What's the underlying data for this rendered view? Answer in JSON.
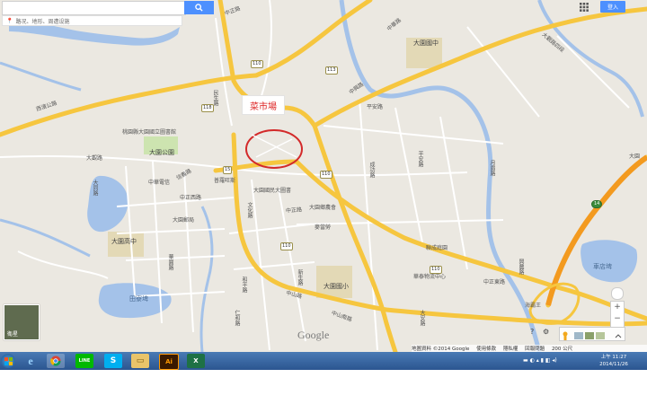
{
  "search": {
    "placeholder": "",
    "hint": "路况、地形、周遭设施"
  },
  "header": {
    "login_label": "登入"
  },
  "map": {
    "annotation": "菜市場",
    "roads": [
      "中正路",
      "中華路",
      "民族路",
      "西濱公路",
      "中興路",
      "大觀路",
      "平安路",
      "月眉路",
      "和平路",
      "仁和路",
      "新生路",
      "中山南路",
      "中正東路",
      "中山路",
      "文化路",
      "信義路",
      "成功路",
      "正光路",
      "中正西路",
      "民生路",
      "華圓路",
      "自立街",
      "大安路",
      "大同路",
      "興農路",
      "大觀路四段"
    ],
    "places": [
      "桃園縣大園國立圖書館",
      "大園公園",
      "中華電信",
      "大園國中",
      "大園高中",
      "大園國小",
      "大園郵局",
      "大園國民大圖書",
      "麥當勞",
      "大園鄉農會",
      "聯成庭園",
      "華泰物流中心",
      "海霸王",
      "普羅旺斯",
      "田寮埤",
      "車店埤",
      "大園"
    ],
    "shields": [
      "110",
      "113",
      "118",
      "15",
      "110",
      "110",
      "110",
      "14",
      "113",
      "15"
    ],
    "satellite_label": "衛星",
    "logo": "Google",
    "attribution": [
      "地圖資料 ©2014 Google",
      "使用條款",
      "隱私權",
      "回報問題",
      "200 公尺"
    ]
  },
  "taskbar": {
    "apps": [
      "start",
      "ie",
      "chrome",
      "line",
      "skype",
      "explorer",
      "illustrator",
      "excel"
    ],
    "clock_time": "上午 11:27",
    "clock_date": "2014/11/26"
  },
  "colors": {
    "highway": "#f6c63f",
    "water": "#a4c2e9",
    "accent": "#4d90fe",
    "circle": "#d32a2a",
    "park": "#cde4b0"
  }
}
